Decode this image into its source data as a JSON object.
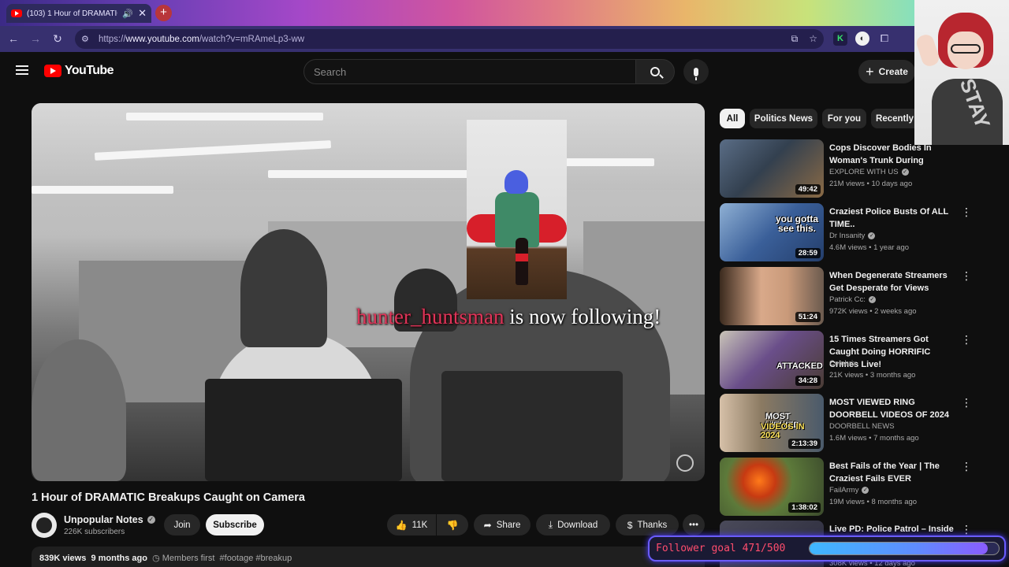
{
  "browser": {
    "tab_title": "(103) 1 Hour of DRAMATIC",
    "url_prefix": "https://",
    "url_host": "www.youtube.com",
    "url_path": "/watch?v=mRAmeLp3-ww"
  },
  "header": {
    "logo_text": "YouTube",
    "search_placeholder": "Search",
    "create_label": "Create"
  },
  "video": {
    "overlay_follower_name": "hunter_huntsman",
    "overlay_follow_text": " is now following!",
    "title": "1 Hour of DRAMATIC Breakups Caught on Camera",
    "channel_name": "Unpopular Notes",
    "subscribers": "226K subscribers",
    "join_label": "Join",
    "subscribe_label": "Subscribe",
    "like_count": "11K",
    "share_label": "Share",
    "download_label": "Download",
    "thanks_label": "Thanks",
    "views": "839K views",
    "age": "9 months ago",
    "members": "Members first",
    "hashtags": "#footage #breakup"
  },
  "chips": [
    {
      "label": "All",
      "active": true
    },
    {
      "label": "Politics News",
      "active": false
    },
    {
      "label": "For you",
      "active": false
    },
    {
      "label": "Recently",
      "active": false
    }
  ],
  "recommendations": [
    {
      "title": "Cops Discover Bodies In Woman's Trunk During",
      "channel": "EXPLORE WITH US",
      "views": "21M views • 10 days ago",
      "duration": "49:42"
    },
    {
      "title": "Craziest Police Busts Of ALL TIME..",
      "channel": "Dr Insanity",
      "views": "4.6M views • 1 year ago",
      "duration": "28:59",
      "thumb_text": "you gotta see this."
    },
    {
      "title": "When Degenerate Streamers Get Desperate for Views",
      "channel": "Patrick Cc:",
      "views": "972K views • 2 weeks ago",
      "duration": "51:24"
    },
    {
      "title": "15 Times Streamers Got Caught Doing HORRIFIC Crimes Live!",
      "channel": "Celebrix",
      "views": "21K views • 3 months ago",
      "duration": "34:28",
      "thumb_text": "ATTACKED"
    },
    {
      "title": "MOST VIEWED RING DOORBELL VIDEOS OF 2024",
      "channel": "DOORBELL NEWS",
      "views": "1.6M views • 7 months ago",
      "duration": "2:13:39",
      "thumb_text_a": "MOST VIEWED",
      "thumb_text_b": "VIDEOS IN 2024"
    },
    {
      "title": "Best Fails of the Year | The Craziest Fails EVER",
      "channel": "FailArmy",
      "views": "19M views • 8 months ago",
      "duration": "1:38:02"
    },
    {
      "title": "Live PD: Police Patrol – Inside",
      "channel": "",
      "views": "308K views • 12 days ago",
      "duration": ""
    }
  ],
  "overlay": {
    "vtuber_shirt_text": "STAY",
    "goal_label": "Follower goal 471/500",
    "goal_current": 471,
    "goal_target": 500
  },
  "colors": {
    "youtube_red": "#ff0000",
    "follower_name": "#e0345a",
    "goal_border": "#6a5cff"
  }
}
